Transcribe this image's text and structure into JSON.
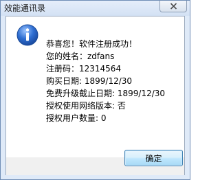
{
  "window": {
    "title": "效能通讯录"
  },
  "icons": {
    "close": "close-icon",
    "info": "info-icon"
  },
  "colors": {
    "info_icon": "#2f6fd2",
    "button_border": "#3c7fb1"
  },
  "message": {
    "lines": [
      "恭喜您！软件注册成功！",
      "您的姓名：zdfans",
      "注册码：12314564",
      "购买日期: 1899/12/30",
      "免费升级截止日期: 1899/12/30",
      "授权使用网络版本: 否",
      "授权用户数量: 0"
    ]
  },
  "buttons": {
    "ok_label": "确定"
  }
}
